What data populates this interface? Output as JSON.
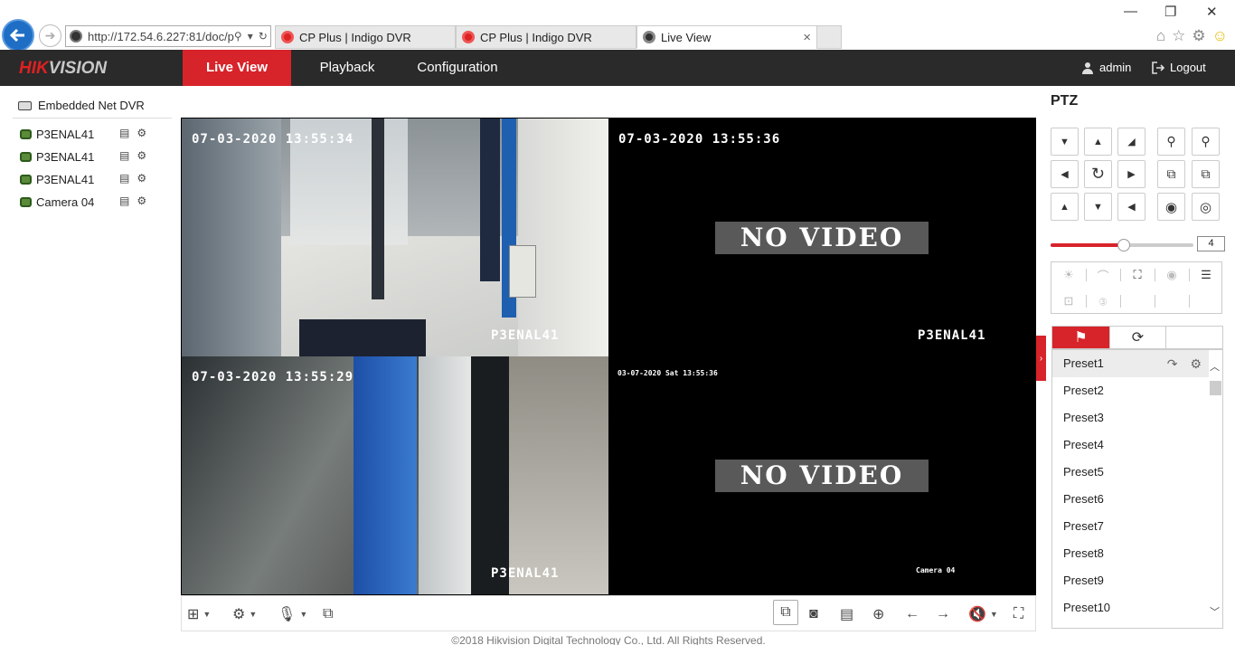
{
  "browser": {
    "address": "http://172.54.6.227:81/doc/p",
    "tabs": [
      {
        "label": "CP Plus | Indigo DVR"
      },
      {
        "label": "CP Plus | Indigo DVR"
      },
      {
        "label": "Live View"
      }
    ],
    "window_controls": {
      "minimize": "—",
      "restore": "❐",
      "close": "✕"
    }
  },
  "app": {
    "brand_red": "HIK",
    "brand_gray": "VISION",
    "menu": [
      "Live View",
      "Playback",
      "Configuration"
    ],
    "user": "admin",
    "logout": "Logout",
    "accent_color": "#d7232a"
  },
  "tree": {
    "root": "Embedded Net DVR",
    "cameras": [
      "P3ENAL41",
      "P3ENAL41",
      "P3ENAL41",
      "Camera 04"
    ]
  },
  "panes": [
    {
      "timestamp": "07-03-2020 13:55:34",
      "name": "P3ENAL41",
      "no_video": ""
    },
    {
      "timestamp": "07-03-2020 13:55:36",
      "name": "P3ENAL41",
      "no_video": "NO VIDEO"
    },
    {
      "timestamp": "07-03-2020 13:55:29",
      "name": "P3ENAL41",
      "no_video": ""
    },
    {
      "timestamp": "03-07-2020 Sat 13:55:36",
      "name": "Camera 04",
      "no_video": "NO VIDEO"
    }
  ],
  "footer": "©2018 Hikvision Digital Technology Co., Ltd. All Rights Reserved.",
  "ptz": {
    "title": "PTZ",
    "speed": "4",
    "speed_fraction": 0.5,
    "presets": [
      "Preset1",
      "Preset2",
      "Preset3",
      "Preset4",
      "Preset5",
      "Preset6",
      "Preset7",
      "Preset8",
      "Preset9",
      "Preset10"
    ]
  }
}
